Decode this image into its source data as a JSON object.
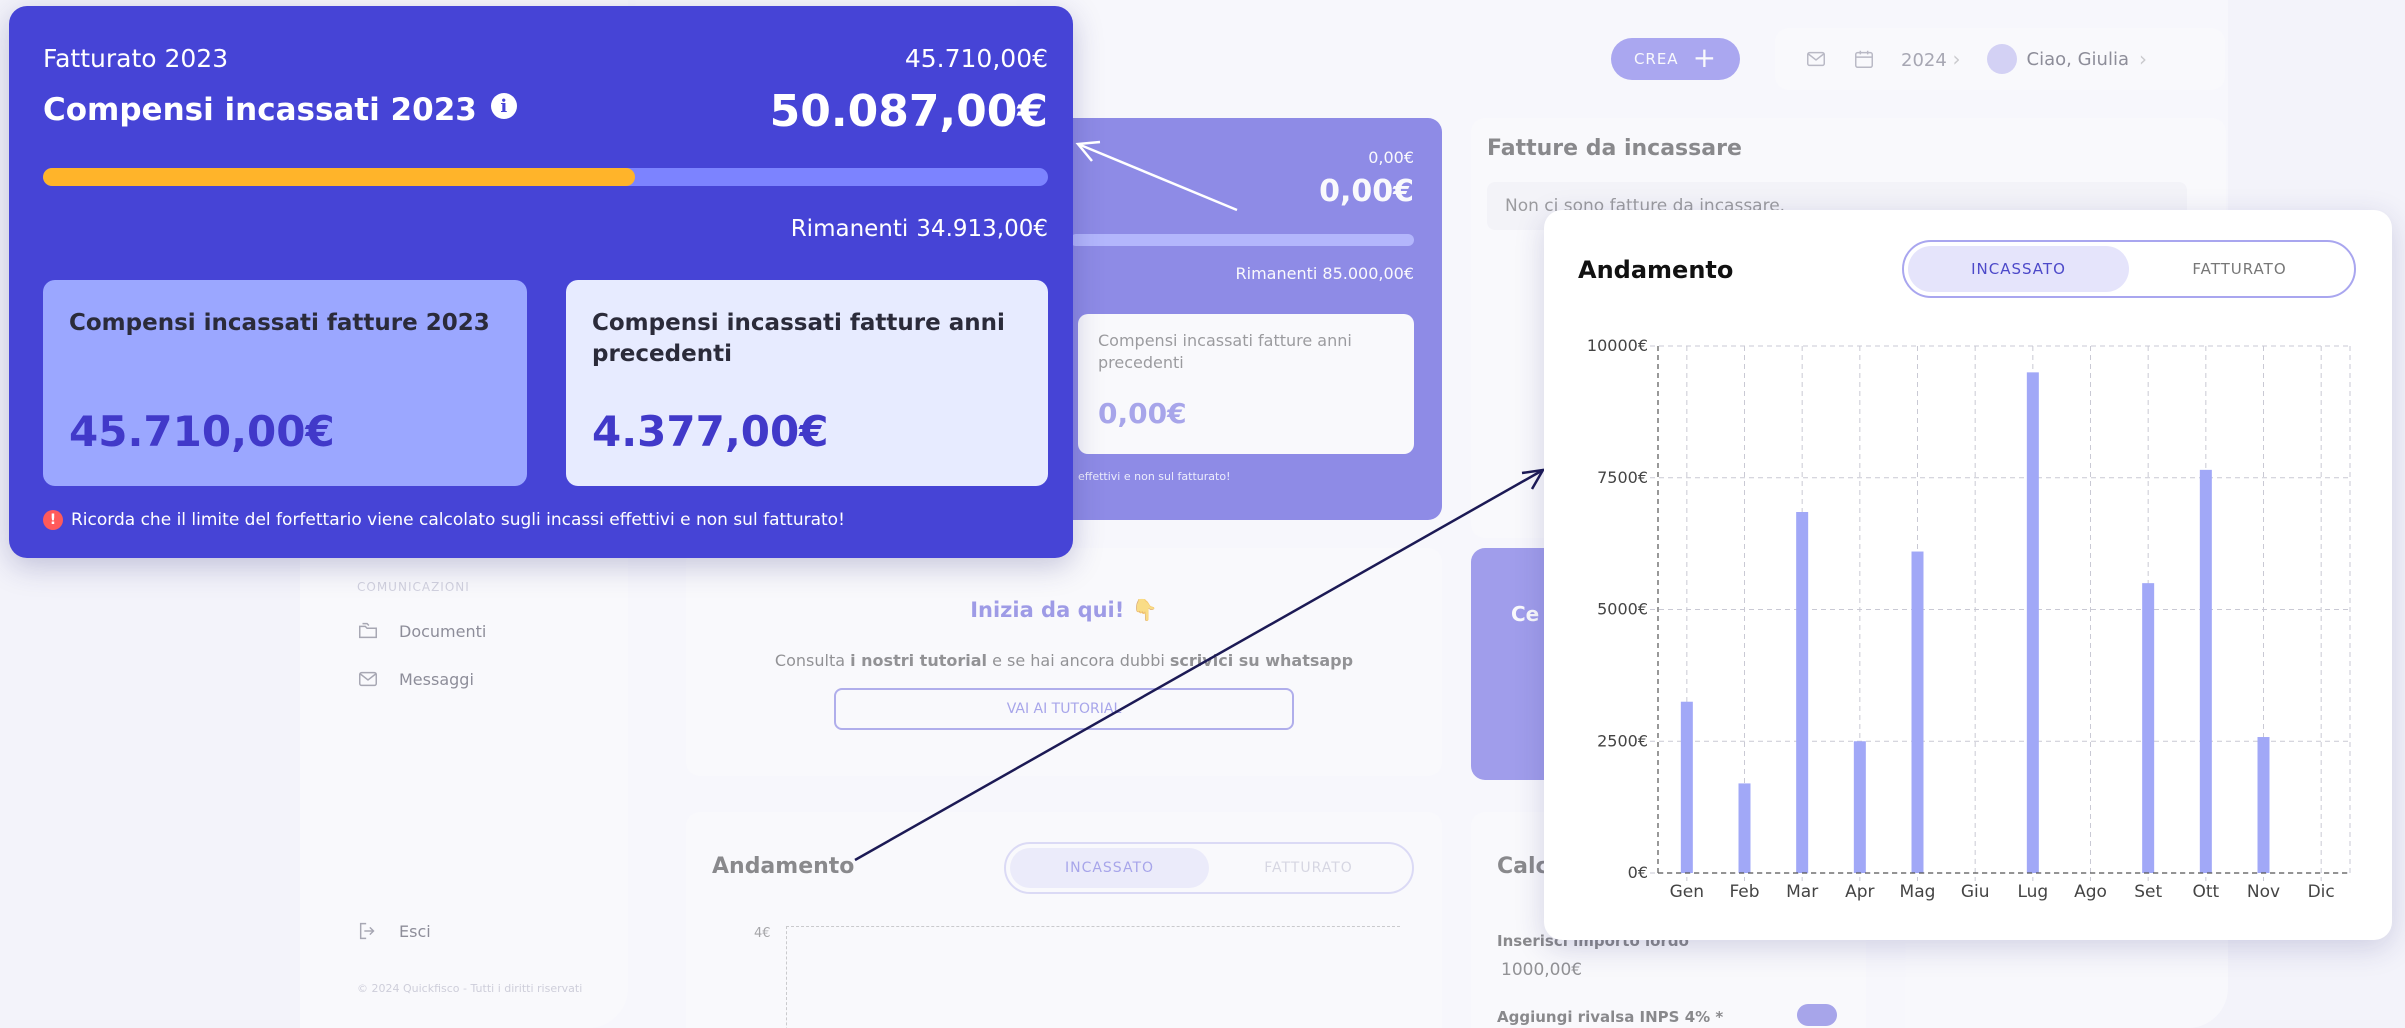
{
  "topbar": {
    "create_label": "CREA",
    "year": "2024",
    "user": "Ciao, Giulia"
  },
  "sidebar": {
    "section_label": "COMUNICAZIONI",
    "items": [
      {
        "label": "Documenti",
        "icon": "folder-icon"
      },
      {
        "label": "Messaggi",
        "icon": "mail-icon"
      }
    ],
    "logout_label": "Esci",
    "footer": "© 2024 Quickfisco - Tutti i diritti riservati"
  },
  "background": {
    "fatturato_small": "0,00€",
    "fatturato_big": "0,00€",
    "rimanenti": "Rimanenti 85.000,00€",
    "subcard_title": "Compensi incassati fatture anni precedenti",
    "subcard_value": "0,00€",
    "note_fragment": "effettivi e non sul fatturato!",
    "fatture_title": "Fatture da incassare",
    "fatture_empty": "Non ci sono fatture da incassare.",
    "inizia_title": "Inizia da qui!",
    "inizia_text_1": "Consulta ",
    "inizia_text_bold_1": "i nostri tutorial",
    "inizia_text_2": " e se hai ancora dubbi ",
    "inizia_text_bold_2": "scrivici su whatsapp",
    "inizia_button": "VAI AI TUTORIAL",
    "cerca_fragment": "Ce",
    "andamento_title": "Andamento",
    "andamento_tab_1": "INCASSATO",
    "andamento_tab_2": "FATTURATO",
    "andamento_ytick": "4€",
    "calc_title": "Calc",
    "calc_label": "Inserisci importo lordo",
    "calc_value": "1000,00€",
    "calc_label_2": "Aggiungi rivalsa INPS 4% *"
  },
  "highlight": {
    "fatturato_label": "Fatturato 2023",
    "fatturato_value": "45.710,00€",
    "compensi_label": "Compensi incassati 2023",
    "compensi_value": "50.087,00€",
    "progress_fraction": 0.589,
    "rimanenti_label": "Rimanenti",
    "rimanenti_value": "34.913,00€",
    "card1_title": "Compensi incassati fatture 2023",
    "card1_value": "45.710,00€",
    "card2_title": "Compensi incassati fatture anni precedenti",
    "card2_value": "4.377,00€",
    "note": "Ricorda che il limite del forfettario viene calcolato sugli incassi effettivi e non sul fatturato!"
  },
  "chart_panel": {
    "title": "Andamento",
    "tabs": [
      {
        "label": "INCASSATO",
        "active": true
      },
      {
        "label": "FATTURATO",
        "active": false
      }
    ]
  },
  "chart_data": {
    "type": "bar",
    "categories": [
      "Gen",
      "Feb",
      "Mar",
      "Apr",
      "Mag",
      "Giu",
      "Lug",
      "Ago",
      "Set",
      "Ott",
      "Nov",
      "Dic"
    ],
    "values": [
      3250,
      1700,
      6850,
      2500,
      6100,
      0,
      9500,
      0,
      5500,
      7650,
      2580,
      0
    ],
    "ylim": [
      0,
      10000
    ],
    "yticks": [
      {
        "value": 0,
        "label": "0€"
      },
      {
        "value": 2500,
        "label": "2500€"
      },
      {
        "value": 5000,
        "label": "5000€"
      },
      {
        "value": 7500,
        "label": "7500€"
      },
      {
        "value": 10000,
        "label": "10000€"
      }
    ],
    "grid": true,
    "bar_color": "#a1a8f7"
  },
  "colors": {
    "primary": "#4644d6",
    "progress": "#ffb42a",
    "track": "#7c83ff",
    "accent": "#6f6ae8",
    "warning": "#ff5a5a"
  }
}
